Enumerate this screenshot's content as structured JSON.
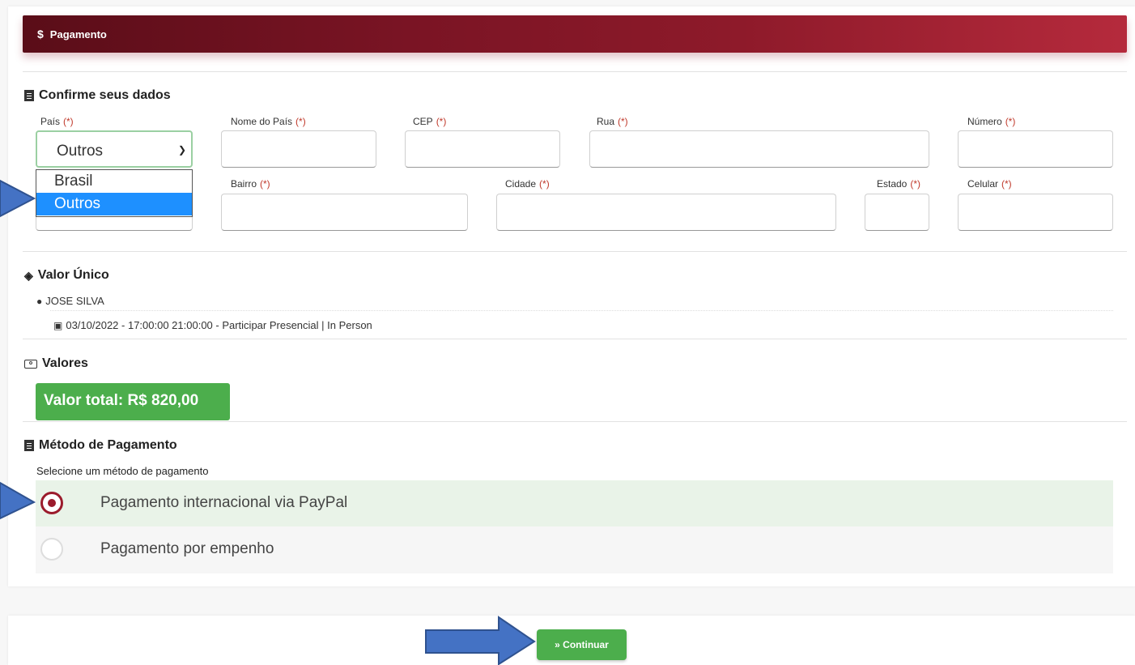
{
  "header": {
    "icon": "dollar-icon",
    "title": "Pagamento"
  },
  "confirm": {
    "title": "Confirme seus dados",
    "required_mark": "(*)",
    "labels": {
      "pais": "País",
      "nome_pais": "Nome do País",
      "cep": "CEP",
      "rua": "Rua",
      "numero": "Número",
      "bairro": "Bairro",
      "cidade": "Cidade",
      "estado": "Estado",
      "celular": "Celular"
    },
    "pais_select": {
      "value": "Outros",
      "options": [
        "Brasil",
        "Outros"
      ],
      "highlighted": "Outros"
    }
  },
  "valor_unico": {
    "title": "Valor Único",
    "person": "JOSE SILVA",
    "event": "03/10/2022 - 17:00:00 21:00:00 - Participar Presencial | In Person"
  },
  "valores": {
    "title": "Valores",
    "total": "Valor total: R$ 820,00"
  },
  "metodo": {
    "title": "Método de Pagamento",
    "hint": "Selecione um método de pagamento",
    "options": [
      {
        "label": "Pagamento internacional via PayPal",
        "selected": true
      },
      {
        "label": "Pagamento por empenho",
        "selected": false
      }
    ]
  },
  "footer": {
    "continue_label": "Continuar",
    "continue_icon": "double-chevron-right-icon"
  },
  "colors": {
    "header": "#7a1424",
    "accent_green": "#4cae4c",
    "radio": "#9b1b2c",
    "highlight": "#1e90ff",
    "arrow": "#4472c4"
  }
}
